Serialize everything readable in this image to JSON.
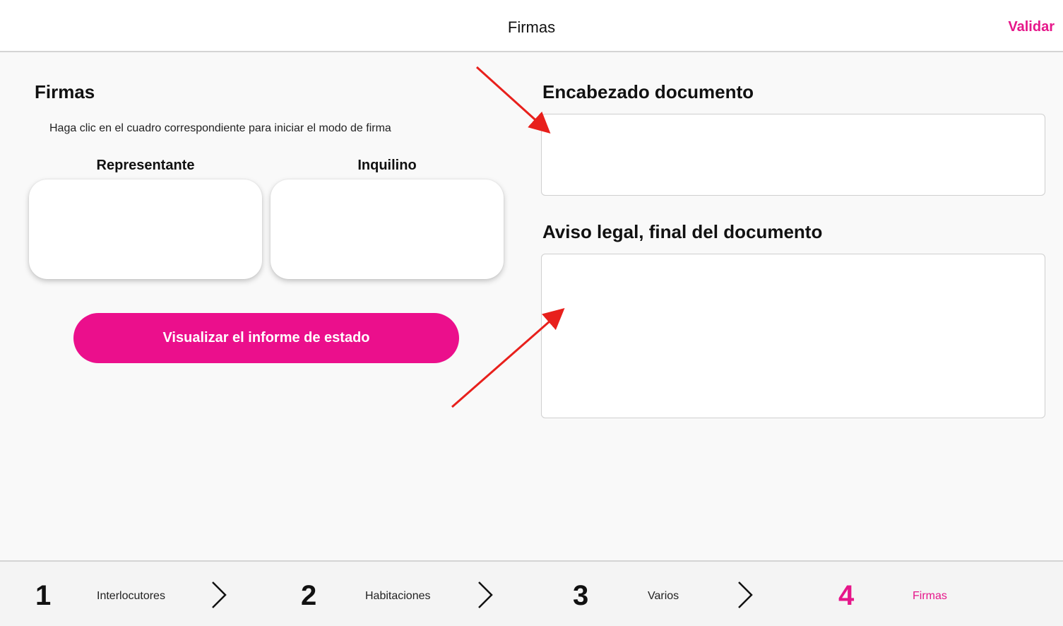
{
  "header": {
    "title": "Firmas",
    "action_label": "Validar"
  },
  "signatures": {
    "title": "Firmas",
    "instructions": "Haga clic en el cuadro correspondiente para iniciar el modo de firma",
    "boxes": [
      {
        "label": "Representante"
      },
      {
        "label": "Inquilino"
      }
    ],
    "view_report_label": "Visualizar el informe de estado"
  },
  "document": {
    "header_title": "Encabezado documento",
    "header_value": "",
    "footer_title": "Aviso legal, final del documento",
    "footer_value": ""
  },
  "stepper": {
    "steps": [
      {
        "number": "1",
        "label": "Interlocutores",
        "active": false
      },
      {
        "number": "2",
        "label": "Habitaciones",
        "active": false
      },
      {
        "number": "3",
        "label": "Varios",
        "active": false
      },
      {
        "number": "4",
        "label": "Firmas",
        "active": true
      }
    ]
  },
  "colors": {
    "accent": "#eb0f8c",
    "annotation_arrow": "#e8201c"
  },
  "icons": {
    "step_separator": "chevron-right-icon",
    "annotation": "arrow-annotation"
  }
}
